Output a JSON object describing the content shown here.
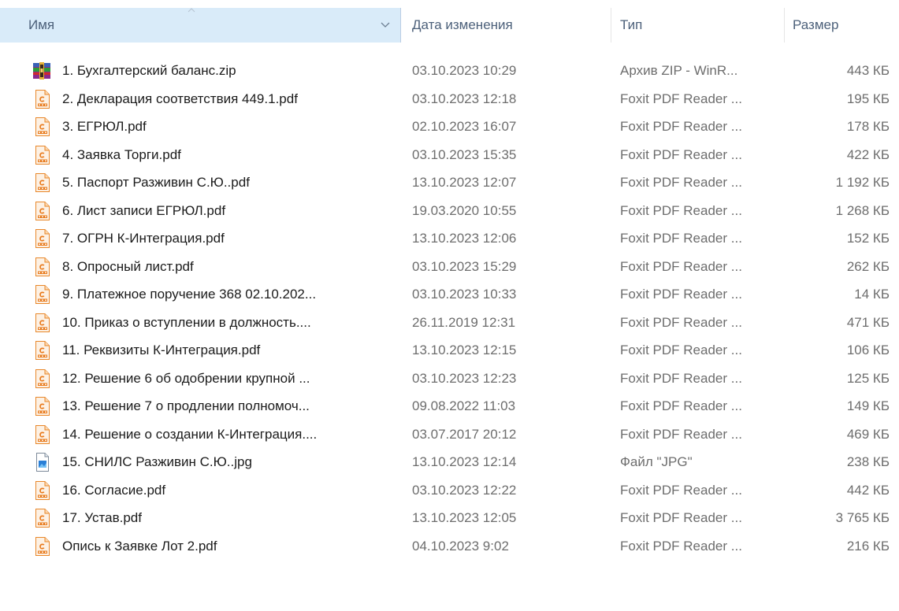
{
  "columns": {
    "name": "Имя",
    "date": "Дата изменения",
    "type": "Тип",
    "size": "Размер"
  },
  "icons": {
    "zip": "winrar-archive-icon",
    "pdf": "foxit-pdf-icon",
    "jpg": "jpg-image-icon"
  },
  "colors": {
    "header_selected_bg": "#d9ebf9",
    "header_text": "#4c607a",
    "pdf_icon": "#f08a24"
  },
  "files": [
    {
      "name": "1. Бухгалтерский баланс.zip",
      "date": "03.10.2023 10:29",
      "type": "Архив ZIP - WinR...",
      "size": "443 КБ",
      "icon": "zip"
    },
    {
      "name": "2. Декларация соответствия 449.1.pdf",
      "date": "03.10.2023 12:18",
      "type": "Foxit PDF Reader ...",
      "size": "195 КБ",
      "icon": "pdf"
    },
    {
      "name": "3. ЕГРЮЛ.pdf",
      "date": "02.10.2023 16:07",
      "type": "Foxit PDF Reader ...",
      "size": "178 КБ",
      "icon": "pdf"
    },
    {
      "name": "4. Заявка Торги.pdf",
      "date": "03.10.2023 15:35",
      "type": "Foxit PDF Reader ...",
      "size": "422 КБ",
      "icon": "pdf"
    },
    {
      "name": "5. Паспорт Разживин С.Ю..pdf",
      "date": "13.10.2023 12:07",
      "type": "Foxit PDF Reader ...",
      "size": "1 192 КБ",
      "icon": "pdf"
    },
    {
      "name": "6. Лист записи ЕГРЮЛ.pdf",
      "date": "19.03.2020 10:55",
      "type": "Foxit PDF Reader ...",
      "size": "1 268 КБ",
      "icon": "pdf"
    },
    {
      "name": "7. ОГРН К-Интеграция.pdf",
      "date": "13.10.2023 12:06",
      "type": "Foxit PDF Reader ...",
      "size": "152 КБ",
      "icon": "pdf"
    },
    {
      "name": "8. Опросный лист.pdf",
      "date": "03.10.2023 15:29",
      "type": "Foxit PDF Reader ...",
      "size": "262 КБ",
      "icon": "pdf"
    },
    {
      "name": "9. Платежное поручение 368 02.10.202...",
      "date": "03.10.2023 10:33",
      "type": "Foxit PDF Reader ...",
      "size": "14 КБ",
      "icon": "pdf"
    },
    {
      "name": "10. Приказ о вступлении в должность....",
      "date": "26.11.2019 12:31",
      "type": "Foxit PDF Reader ...",
      "size": "471 КБ",
      "icon": "pdf"
    },
    {
      "name": "11. Реквизиты К-Интеграция.pdf",
      "date": "13.10.2023 12:15",
      "type": "Foxit PDF Reader ...",
      "size": "106 КБ",
      "icon": "pdf"
    },
    {
      "name": "12. Решение 6 об одобрении крупной ...",
      "date": "03.10.2023 12:23",
      "type": "Foxit PDF Reader ...",
      "size": "125 КБ",
      "icon": "pdf"
    },
    {
      "name": "13. Решение 7 о продлении полномоч...",
      "date": "09.08.2022 11:03",
      "type": "Foxit PDF Reader ...",
      "size": "149 КБ",
      "icon": "pdf"
    },
    {
      "name": "14. Решение о создании К-Интеграция....",
      "date": "03.07.2017 20:12",
      "type": "Foxit PDF Reader ...",
      "size": "469 КБ",
      "icon": "pdf"
    },
    {
      "name": "15. СНИЛС Разживин С.Ю..jpg",
      "date": "13.10.2023 12:14",
      "type": "Файл \"JPG\"",
      "size": "238 КБ",
      "icon": "jpg"
    },
    {
      "name": "16. Согласие.pdf",
      "date": "03.10.2023 12:22",
      "type": "Foxit PDF Reader ...",
      "size": "442 КБ",
      "icon": "pdf"
    },
    {
      "name": "17. Устав.pdf",
      "date": "13.10.2023 12:05",
      "type": "Foxit PDF Reader ...",
      "size": "3 765 КБ",
      "icon": "pdf"
    },
    {
      "name": "Опись к Заявке Лот 2.pdf",
      "date": "04.10.2023 9:02",
      "type": "Foxit PDF Reader ...",
      "size": "216 КБ",
      "icon": "pdf"
    }
  ]
}
